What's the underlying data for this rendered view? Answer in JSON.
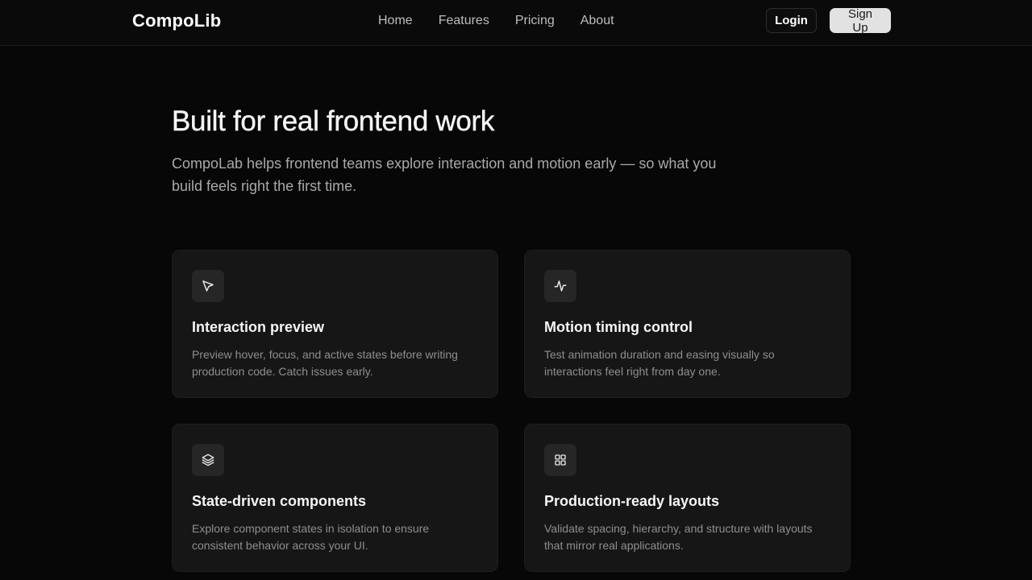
{
  "nav": {
    "logo": "CompoLib",
    "links": [
      "Home",
      "Features",
      "Pricing",
      "About"
    ],
    "login_label": "Login",
    "signup_label": "Sign Up"
  },
  "hero": {
    "title": "Built for real frontend work",
    "description": "CompoLab helps frontend teams explore interaction and motion early — so what you build feels right the first time."
  },
  "features": [
    {
      "icon": "cursor-pointer-icon",
      "title": "Interaction preview",
      "description": "Preview hover, focus, and active states before writing production code. Catch issues early."
    },
    {
      "icon": "activity-pulse-icon",
      "title": "Motion timing control",
      "description": "Test animation duration and easing visually so interactions feel right from day one."
    },
    {
      "icon": "layers-icon",
      "title": "State-driven components",
      "description": "Explore component states in isolation to ensure consistent behavior across your UI."
    },
    {
      "icon": "grid-icon",
      "title": "Production-ready layouts",
      "description": "Validate spacing, hierarchy, and structure with layouts that mirror real applications."
    }
  ]
}
